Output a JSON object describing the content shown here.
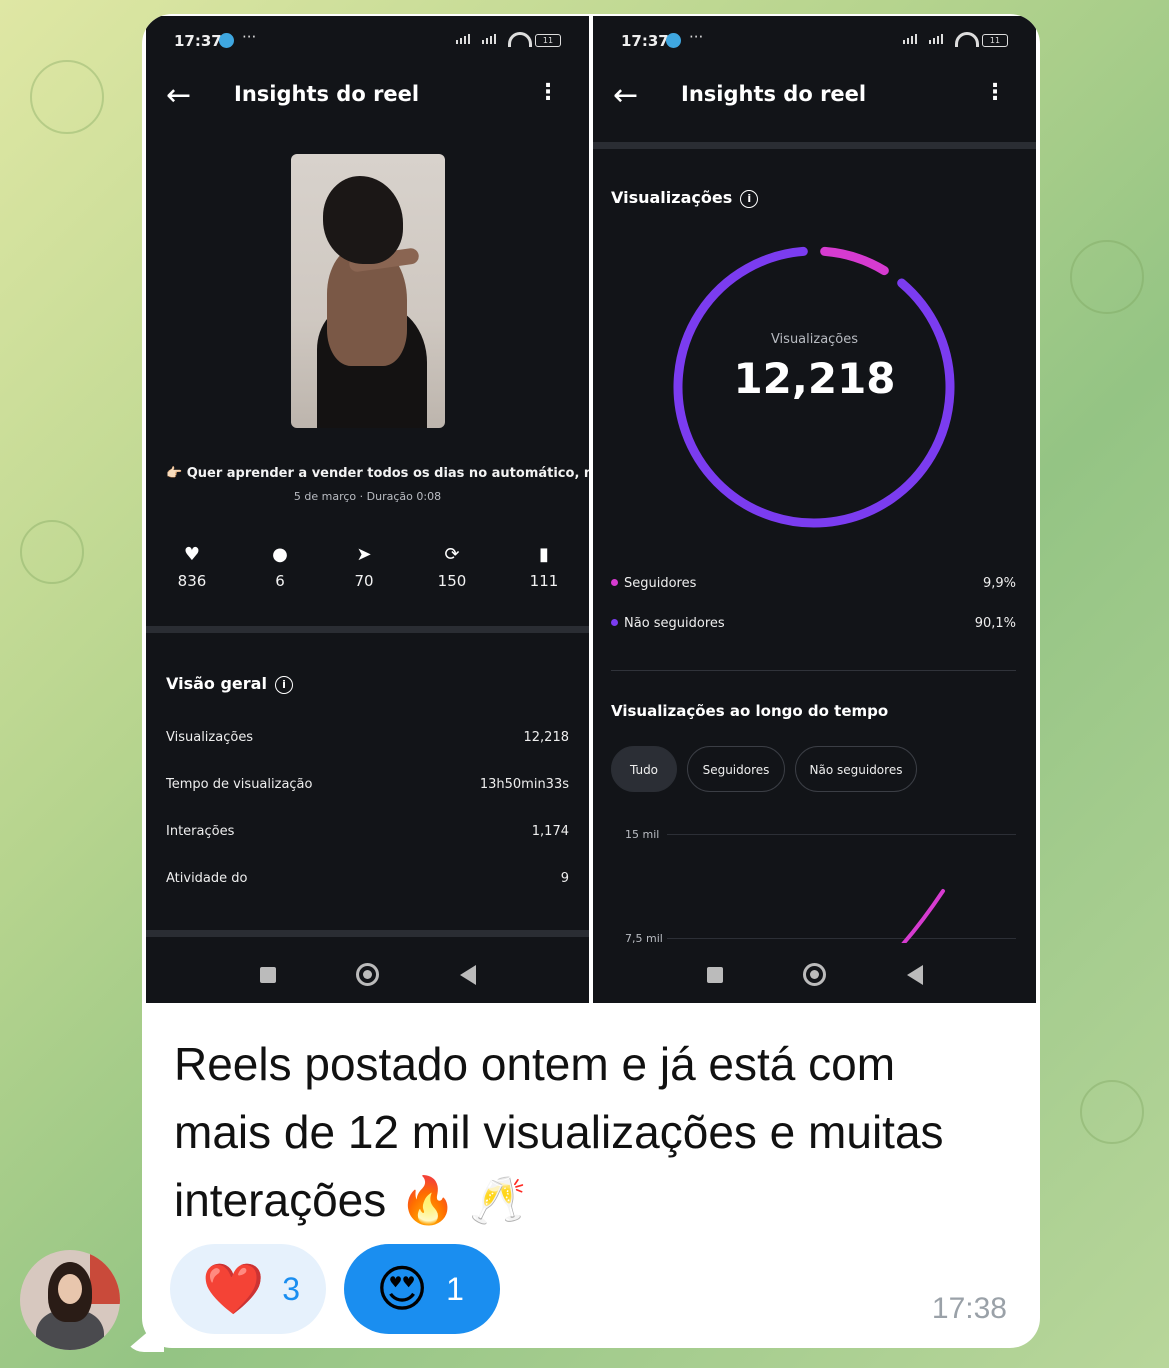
{
  "left_screen": {
    "status_time": "17:37",
    "status_dots": "···",
    "battery": "11",
    "title": "Insights do reel",
    "caption": "👉🏻 Quer aprender a vender todos os dias no automático, me...",
    "meta": "5 de março · Duração 0:08",
    "stats": [
      {
        "icon": "heart-icon",
        "glyph": "♥",
        "value": "836"
      },
      {
        "icon": "comment-icon",
        "glyph": "●",
        "value": "6"
      },
      {
        "icon": "share-icon",
        "glyph": "➤",
        "value": "70"
      },
      {
        "icon": "repost-icon",
        "glyph": "⟳",
        "value": "150"
      },
      {
        "icon": "save-icon",
        "glyph": "▮",
        "value": "111"
      }
    ],
    "overview_title": "Visão geral",
    "overview_rows": [
      {
        "label": "Visualizações",
        "value": "12,218"
      },
      {
        "label": "Tempo de visualização",
        "value": "13h50min33s"
      },
      {
        "label": "Interações",
        "value": "1,174"
      },
      {
        "label": "Atividade do",
        "value": "9"
      }
    ]
  },
  "right_screen": {
    "status_time": "17:37",
    "status_dots": "···",
    "battery": "11",
    "title": "Insights do reel",
    "views_title": "Visualizações",
    "donut_label": "Visualizações",
    "donut_value": "12,218",
    "legend": [
      {
        "label": "Seguidores",
        "value": "9,9%",
        "color": "#d63bd0"
      },
      {
        "label": "Não seguidores",
        "value": "90,1%",
        "color": "#7b3cf0"
      }
    ],
    "over_time_title": "Visualizações ao longo do tempo",
    "chips": [
      "Tudo",
      "Seguidores",
      "Não seguidores"
    ],
    "axis": [
      "15 mil",
      "7,5 mil"
    ]
  },
  "message": {
    "text": "Reels postado ontem e já está com mais de 12 mil visualizações e muitas interações 🔥 🥂",
    "time": "17:38",
    "reactions": [
      {
        "emoji": "❤️",
        "count": "3"
      },
      {
        "emoji": "😍",
        "count": "1"
      }
    ]
  },
  "colors": {
    "accent_blue": "#1a8ef0",
    "reaction_light": "#e6f1fc",
    "donut_purple": "#7b3cf0",
    "donut_pink": "#d63bd0"
  }
}
